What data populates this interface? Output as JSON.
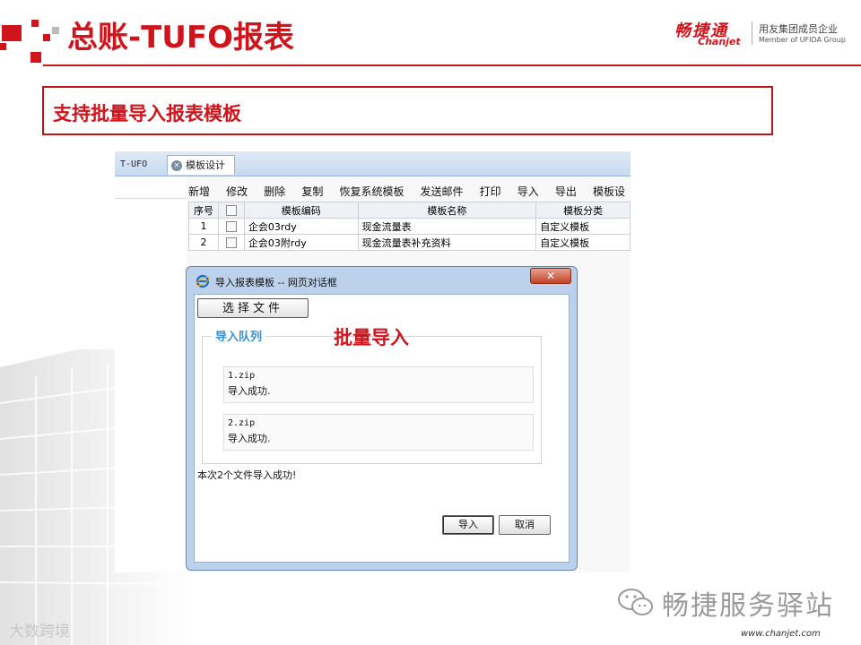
{
  "slide": {
    "title": "总账-TUFO报表",
    "subtitle": "支持批量导入报表模板",
    "annotation": "批量导入",
    "accent": "#d0141c"
  },
  "brand": {
    "name_cn": "畅捷通",
    "name_en": "Chanjet",
    "tagline_cn": "用友集团成员企业",
    "tagline_en": "Member of UFIDA Group"
  },
  "app": {
    "tabs": [
      {
        "label": "T-UFO"
      },
      {
        "label": "模板设计",
        "icon": "close-icon"
      }
    ],
    "toolbar": [
      "新增",
      "修改",
      "删除",
      "复制",
      "恢复系统模板",
      "发送邮件",
      "打印",
      "导入",
      "导出",
      "模板设"
    ],
    "table": {
      "headers": [
        "序号",
        "",
        "模板编码",
        "模板名称",
        "模板分类"
      ],
      "rows": [
        {
          "no": "1",
          "code": "企会03rdy",
          "name": "现金流量表",
          "category": "自定义模板"
        },
        {
          "no": "2",
          "code": "企会03附rdy",
          "name": "现金流量表补充资料",
          "category": "自定义模板"
        }
      ]
    }
  },
  "dialog": {
    "title": "导入报表模板 -- 网页对话框",
    "choose_file": "选择文件",
    "queue_label": "导入队列",
    "items": [
      {
        "file": "1.zip",
        "status": "导入成功."
      },
      {
        "file": "2.zip",
        "status": "导入成功."
      }
    ],
    "summary": "本次2个文件导入成功!",
    "ok_label": "导入",
    "cancel_label": "取消"
  },
  "footer": {
    "wechat": "畅捷服务驿站",
    "url": "www.chanjet.com",
    "watermark": "大数跨境"
  }
}
